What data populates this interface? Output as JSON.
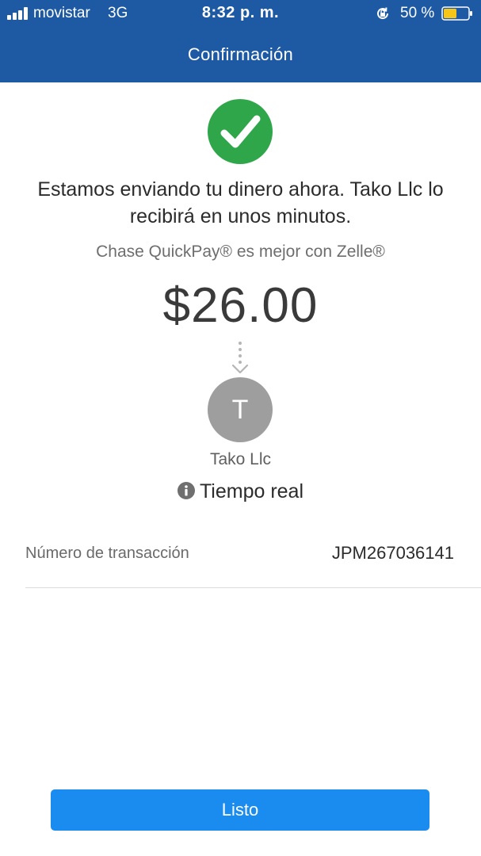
{
  "status_bar": {
    "carrier": "movistar",
    "network": "3G",
    "time": "8:32 p. m.",
    "battery_percent": "50 %",
    "icons": [
      "signal-bars-icon",
      "rotation-lock-icon",
      "battery-icon"
    ]
  },
  "header": {
    "title": "Confirmación",
    "background_color": "#1d5aa3"
  },
  "confirmation": {
    "icon": "checkmark-circle-icon",
    "icon_color": "#2fa64a",
    "message": "Estamos enviando tu dinero ahora. Tako Llc lo recibirá en unos minutos.",
    "subtitle": "Chase QuickPay® es mejor con Zelle®",
    "amount": "$26.00"
  },
  "recipient": {
    "initial": "T",
    "name": "Tako Llc",
    "delivery_speed": "Tiempo real",
    "delivery_icon": "info-icon"
  },
  "details": {
    "transaction_label": "Número de transacción",
    "transaction_number": "JPM267036141"
  },
  "actions": {
    "done_label": "Listo",
    "button_color": "#1a8cf0"
  }
}
